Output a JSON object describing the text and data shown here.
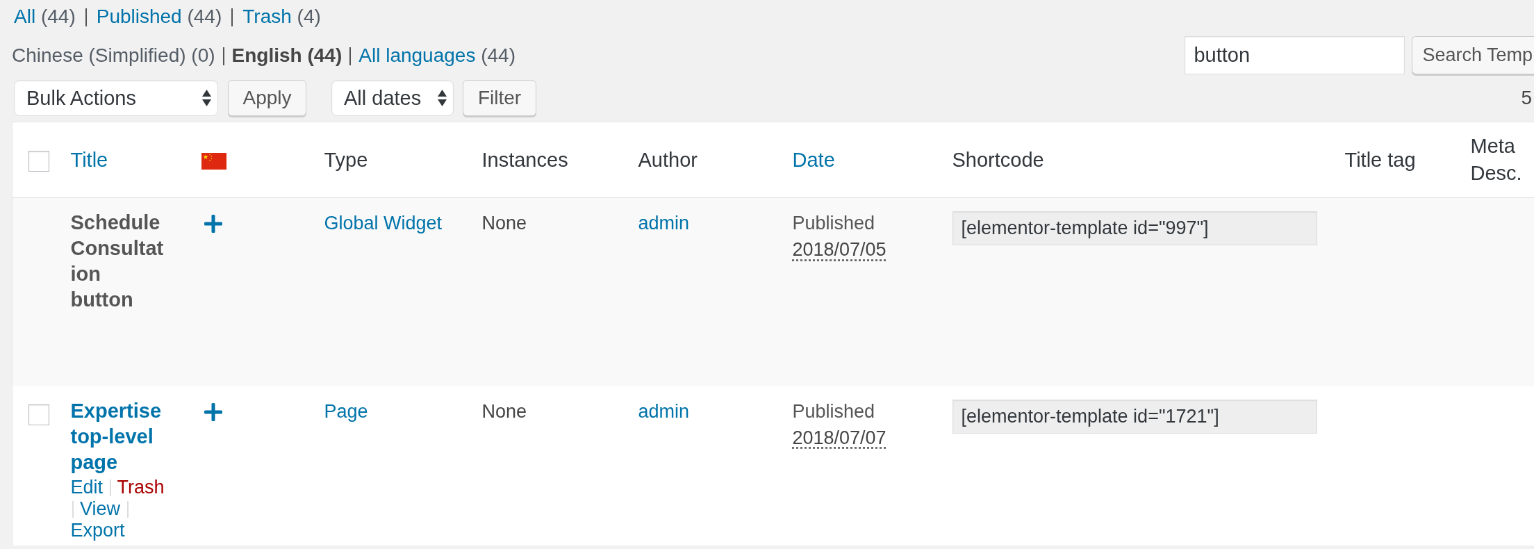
{
  "status_links": [
    {
      "label": "All",
      "count": "(44)",
      "selected": false
    },
    {
      "label": "Published",
      "count": "(44)",
      "selected": false
    },
    {
      "label": "Trash",
      "count": "(4)",
      "selected": false
    }
  ],
  "language_links": [
    {
      "label": "Chinese (Simplified)",
      "count": "(0)",
      "selected": false,
      "disabled": true
    },
    {
      "label": "English",
      "count": "(44)",
      "selected": true,
      "disabled": false
    },
    {
      "label": "All languages",
      "count": "(44)",
      "selected": false,
      "disabled": false
    }
  ],
  "search": {
    "value": "button",
    "button": "Search Temp"
  },
  "tablenav": {
    "bulk_actions": "Bulk Actions",
    "apply": "Apply",
    "dates": "All dates",
    "filter": "Filter",
    "item_count": "5"
  },
  "table": {
    "select_all": {
      "checked": false
    },
    "columns": [
      {
        "kind": "text",
        "label": "Title",
        "sortable": true
      },
      {
        "kind": "flag"
      },
      {
        "kind": "text",
        "label": "Type",
        "sortable": false
      },
      {
        "kind": "text",
        "label": "Instances",
        "sortable": false
      },
      {
        "kind": "text",
        "label": "Author",
        "sortable": false
      },
      {
        "kind": "text",
        "label": "Date",
        "sortable": true
      },
      {
        "kind": "text",
        "label": "Shortcode",
        "sortable": false
      },
      {
        "kind": "text",
        "label": "Title tag",
        "sortable": false
      },
      {
        "kind": "text",
        "label": "Meta Desc.",
        "sortable": false
      }
    ],
    "rows": [
      {
        "title": "Schedule Consultation button",
        "linked": false,
        "type": "Global Widget",
        "instances": "None",
        "author": "admin",
        "status": "Published",
        "date": "2018/07/05",
        "shortcode": "[elementor-template id=\"997\"]"
      },
      {
        "checked": false,
        "title": "Expertise top-level page",
        "linked": true,
        "row_actions": [
          {
            "label": "Edit",
            "kind": "link"
          },
          {
            "label": "Trash",
            "kind": "delete"
          },
          {
            "label": "View",
            "kind": "link"
          },
          {
            "label": "Export",
            "kind": "link"
          }
        ],
        "type": "Page",
        "instances": "None",
        "author": "admin",
        "status": "Published",
        "date": "2018/07/07",
        "shortcode": "[elementor-template id=\"1721\"]"
      }
    ]
  }
}
